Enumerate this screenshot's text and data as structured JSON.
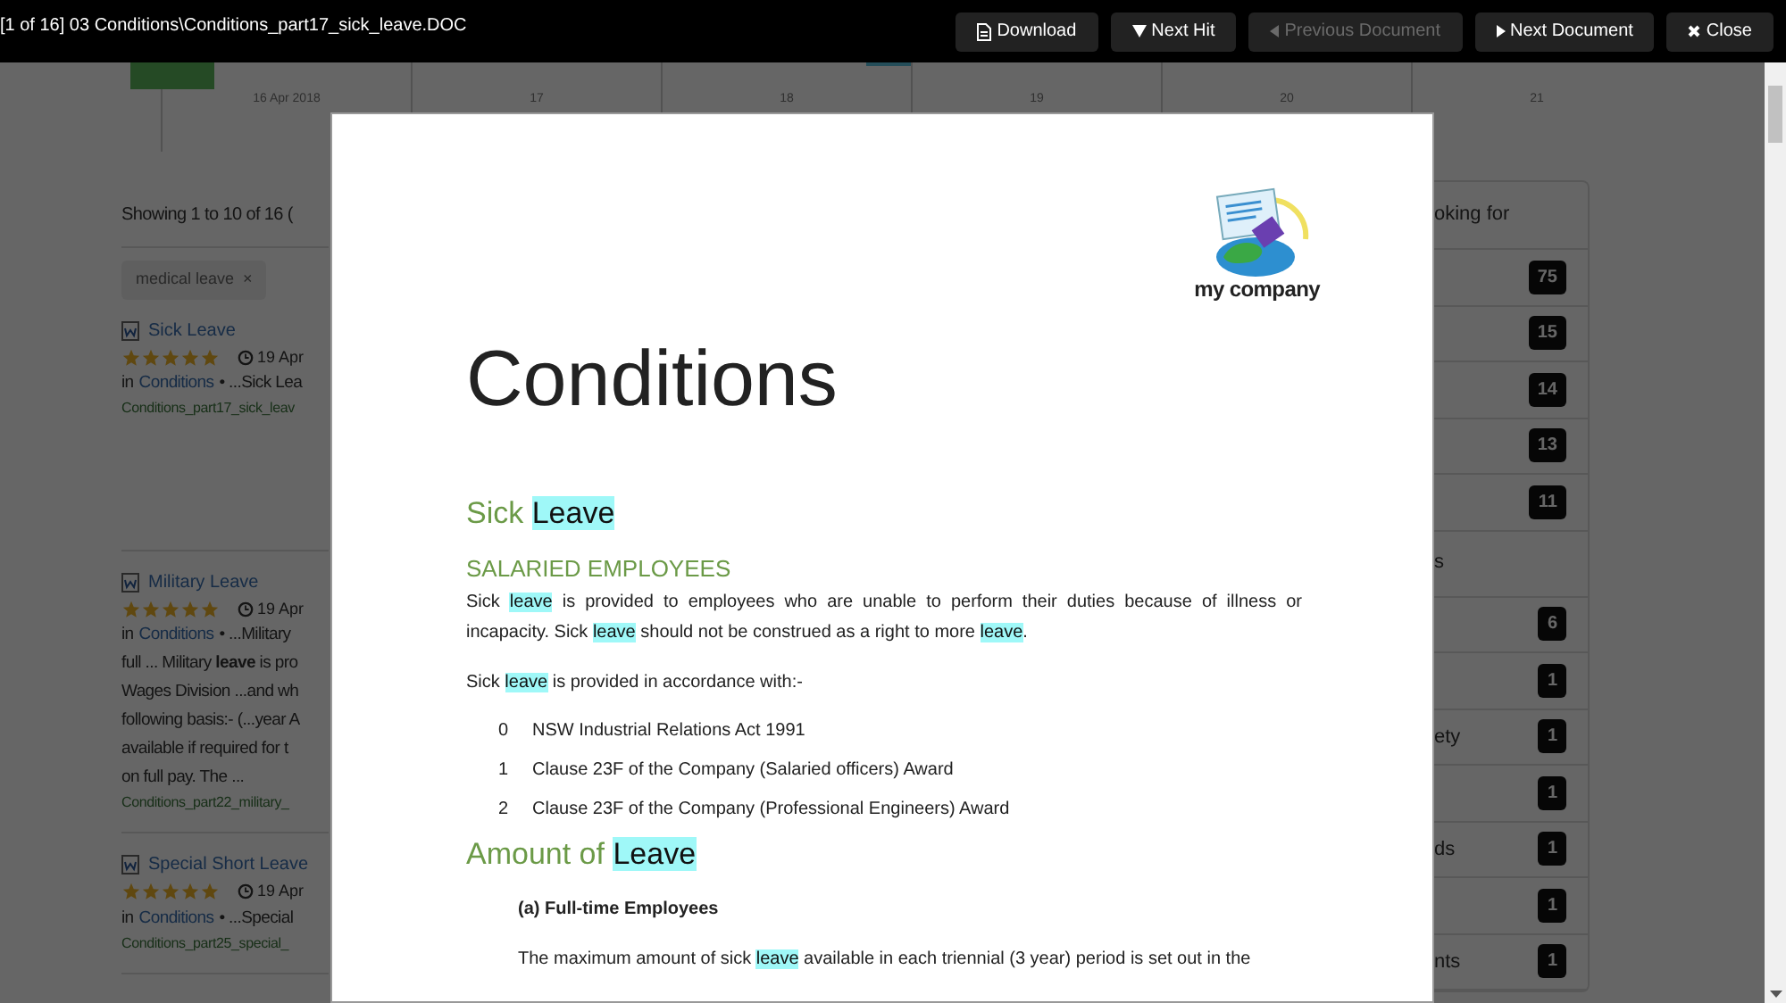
{
  "viewer": {
    "title": "[1 of 16] 03 Conditions\\Conditions_part17_sick_leave.DOC",
    "buttons": [
      {
        "label": "Download",
        "disabled": false
      },
      {
        "label": "Next Hit",
        "disabled": false
      },
      {
        "label": "Previous Document",
        "disabled": true
      },
      {
        "label": "Next Document",
        "disabled": false
      },
      {
        "label": "Close",
        "disabled": false
      }
    ]
  },
  "timeline": {
    "labels": [
      "16 Apr 2018",
      "17",
      "18",
      "19",
      "20",
      "21"
    ]
  },
  "results": {
    "summary": "Showing 1 to 10 of 16 (",
    "filter": {
      "label": "medical leave",
      "remove": "×"
    },
    "items": [
      {
        "title": "Sick Leave",
        "stars": 5,
        "date": "19 Apr",
        "in_label": "in",
        "category": "Conditions",
        "snippet": [
          "• ...Sick Lea"
        ],
        "file": "Conditions_part17_sick_leav"
      },
      {
        "title": "Military Leave",
        "stars": 5,
        "date": "19 Apr",
        "in_label": "in",
        "category": "Conditions",
        "snippet": [
          "• ...Military",
          "full ... Military **leave** is pro",
          "Wages Division ...and wh",
          "following basis:- (...year A",
          "available if required for t",
          "on full pay. The ..."
        ],
        "file": "Conditions_part22_military_"
      },
      {
        "title": "Special Short Leave",
        "stars": 5,
        "date": "19 Apr",
        "in_label": "in",
        "category": "Conditions",
        "snippet": [
          "• ...Special"
        ],
        "file": "Conditions_part25_special_"
      }
    ]
  },
  "facets": {
    "heading": "oking for",
    "rows": [
      {
        "kind": "count",
        "count": "75"
      },
      {
        "kind": "count",
        "count": "15"
      },
      {
        "kind": "count",
        "count": "14"
      },
      {
        "kind": "count",
        "count": "13"
      },
      {
        "kind": "count",
        "count": "11"
      },
      {
        "kind": "heading",
        "label": "s"
      },
      {
        "kind": "count",
        "count": "6"
      },
      {
        "kind": "count",
        "count": "1"
      },
      {
        "kind": "count",
        "label": "ety",
        "count": "1"
      },
      {
        "kind": "count",
        "count": "1"
      },
      {
        "kind": "count",
        "label": "ds",
        "count": "1"
      },
      {
        "kind": "count",
        "count": "1"
      },
      {
        "kind": "count",
        "label": "nts",
        "count": "1"
      }
    ]
  },
  "document": {
    "logo_text": "my company",
    "title": "Conditions",
    "blocks": [
      {
        "kind": "heading",
        "segments": [
          {
            "text": "Sick ",
            "highlight": false
          },
          {
            "text": "Leave",
            "highlight": true
          }
        ]
      },
      {
        "kind": "subheading",
        "segments": [
          {
            "text": "SALARIED EMPLOYEES",
            "highlight": false
          }
        ]
      },
      {
        "kind": "paragraph",
        "segments": [
          {
            "text": "Sick ",
            "highlight": false
          },
          {
            "text": "leave",
            "highlight": true
          },
          {
            "text": " is provided to employees who are unable to perform their duties because of illness or incapacity.  Sick ",
            "highlight": false
          },
          {
            "text": "leave",
            "highlight": true
          },
          {
            "text": " should not be construed as a right to more ",
            "highlight": false
          },
          {
            "text": "leave",
            "highlight": true
          },
          {
            "text": ".",
            "highlight": false
          }
        ]
      },
      {
        "kind": "paragraph",
        "segments": [
          {
            "text": "Sick ",
            "highlight": false
          },
          {
            "text": "leave",
            "highlight": true
          },
          {
            "text": " is provided in accordance with:-",
            "highlight": false
          }
        ]
      },
      {
        "kind": "list_item",
        "number": "0",
        "text": "NSW Industrial Relations Act 1991"
      },
      {
        "kind": "list_item",
        "number": "1",
        "text": "Clause 23F of the Company (Salaried officers) Award"
      },
      {
        "kind": "list_item",
        "number": "2",
        "text": "Clause 23F of the Company (Professional Engineers) Award"
      },
      {
        "kind": "heading",
        "segments": [
          {
            "text": "Amount of ",
            "highlight": false
          },
          {
            "text": "Leave",
            "highlight": true
          }
        ]
      },
      {
        "kind": "bold",
        "text": "(a) Full-time Employees"
      },
      {
        "kind": "indented",
        "segments": [
          {
            "text": "The maximum amount of sick ",
            "highlight": false
          },
          {
            "text": "leave",
            "highlight": true
          },
          {
            "text": " available in each triennial (3 year) period is set out in the",
            "highlight": false
          }
        ]
      }
    ]
  }
}
